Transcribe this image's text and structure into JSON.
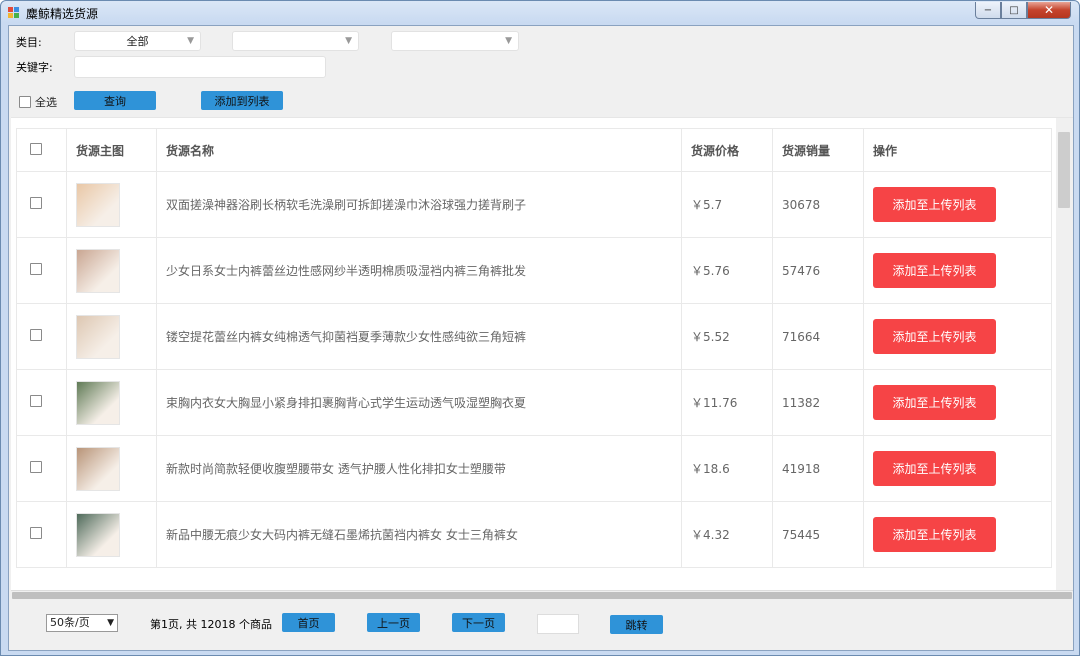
{
  "window": {
    "title": "麋鲸精选货源",
    "minimize_label": "−",
    "maximize_label": "□",
    "close_label": "✕"
  },
  "filters": {
    "category_label": "类目:",
    "category_value": "全部",
    "category2_value": "",
    "category3_value": "",
    "keyword_label": "关键字:",
    "keyword_value": "",
    "select_all_label": "全选",
    "query_button": "查询",
    "add_to_list_button": "添加到列表"
  },
  "table": {
    "headers": [
      "货源主图",
      "货源名称",
      "货源价格",
      "货源销量",
      "操作"
    ],
    "action_label": "添加至上传列表",
    "rows": [
      {
        "name": "双面搓澡神器浴刷长柄软毛洗澡刷可拆卸搓澡巾沐浴球强力搓背刷子",
        "price": "￥5.7",
        "sales": "30678",
        "thumb_color": "#e9c7a6"
      },
      {
        "name": "少女日系女士内裤蕾丝边性感网纱半透明棉质吸湿裆内裤三角裤批发",
        "price": "￥5.76",
        "sales": "57476",
        "thumb_color": "#c9a692"
      },
      {
        "name": "镂空提花蕾丝内裤女纯棉透气抑菌裆夏季薄款少女性感纯欲三角短裤",
        "price": "￥5.52",
        "sales": "71664",
        "thumb_color": "#ddc7b2"
      },
      {
        "name": "束胸内衣女大胸显小紧身排扣裹胸背心式学生运动透气吸湿塑胸衣夏",
        "price": "￥11.76",
        "sales": "11382",
        "thumb_color": "#5f7a55"
      },
      {
        "name": "新款时尚简款轻便收腹塑腰带女 透气护腰人性化排扣女士塑腰带",
        "price": "￥18.6",
        "sales": "41918",
        "thumb_color": "#b89478"
      },
      {
        "name": "新品中腰无痕少女大码内裤无缝石墨烯抗菌裆内裤女 女士三角裤女",
        "price": "￥4.32",
        "sales": "75445",
        "thumb_color": "#4e6a5a"
      }
    ]
  },
  "pagination": {
    "page_size": "50条/页",
    "info": "第1页, 共 12018 个商品",
    "first": "首页",
    "prev": "上一页",
    "next": "下一页",
    "jump_value": "",
    "jump": "跳转"
  },
  "colors": {
    "accent_blue": "#2f93d8",
    "action_red": "#f64446"
  }
}
